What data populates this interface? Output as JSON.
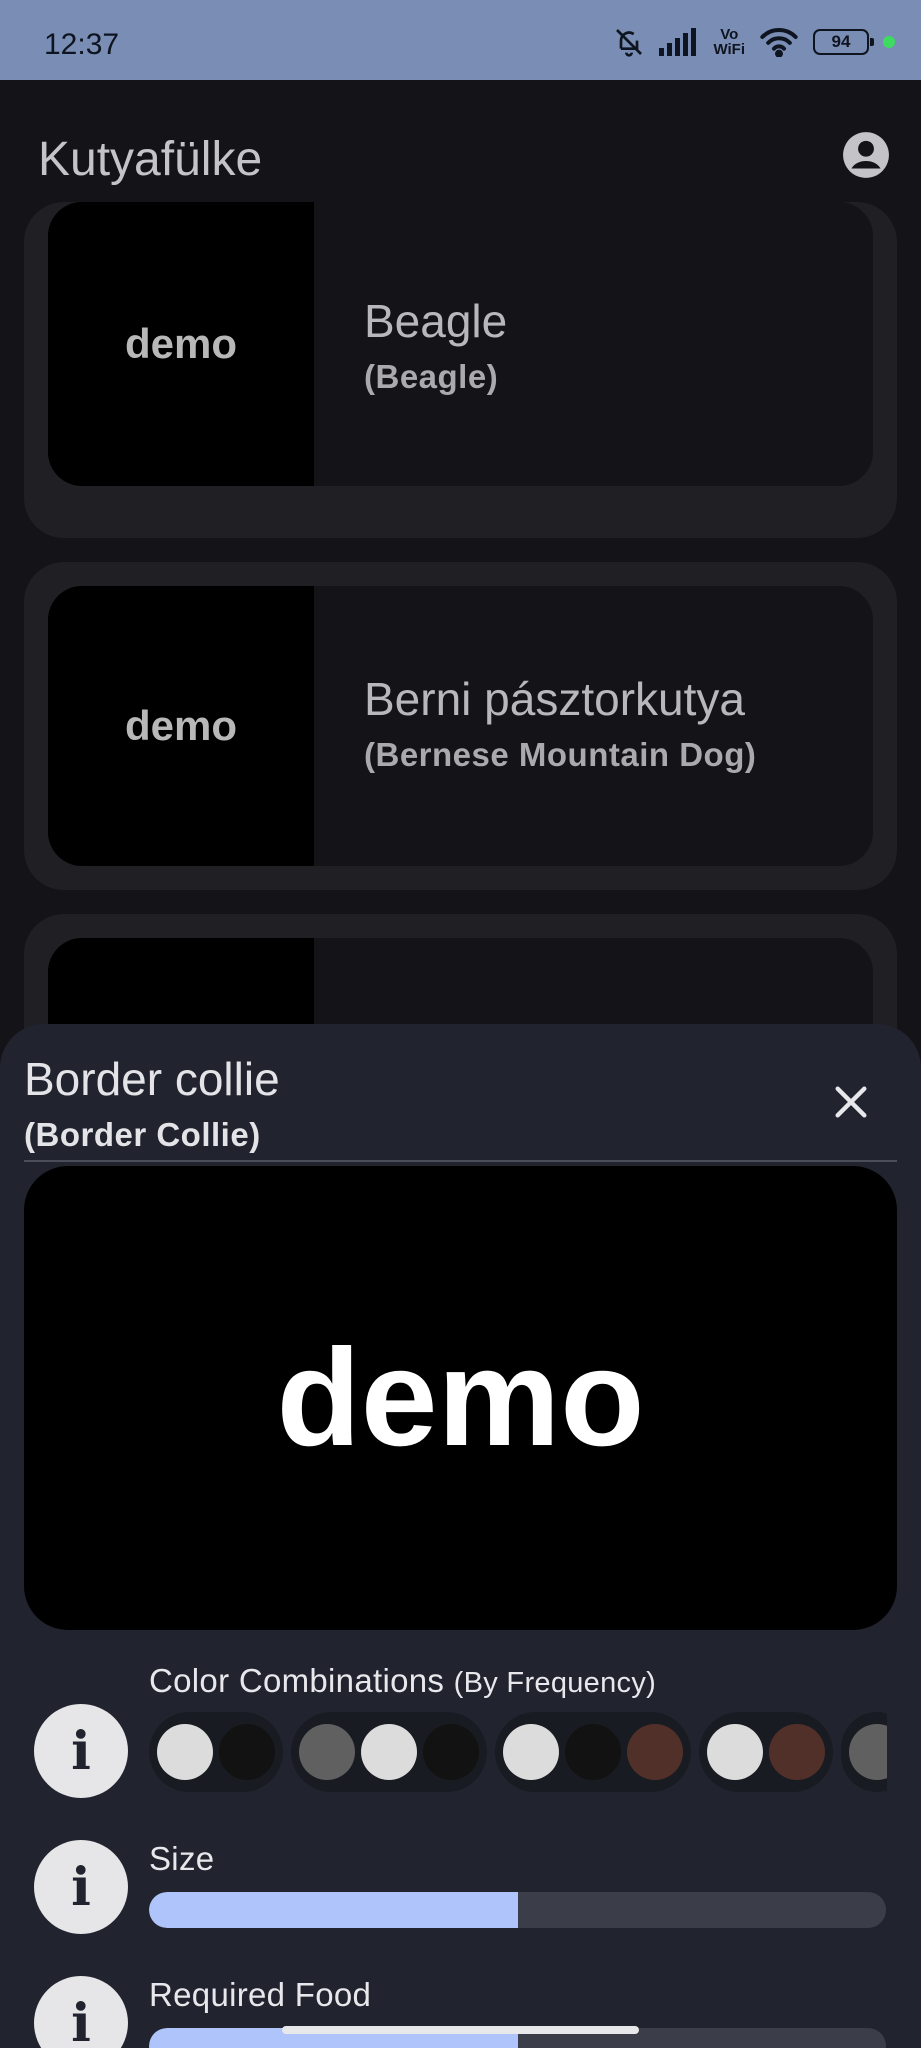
{
  "status_bar": {
    "time": "12:37",
    "network_label_top": "Vo",
    "network_label_bottom": "WiFi",
    "battery": "94",
    "icons": [
      "bell-muted-icon",
      "signal-icon",
      "vowifi-icon",
      "wifi-icon",
      "battery-icon"
    ]
  },
  "app_bar": {
    "title": "Kutyafülke",
    "account_icon": "account-circle-icon"
  },
  "list": {
    "items": [
      {
        "thumb_text": "demo",
        "name": "Beagle",
        "name_en": "(Beagle)"
      },
      {
        "thumb_text": "demo",
        "name": "Berni pásztorkutya",
        "name_en": "(Bernese Mountain Dog)"
      },
      {
        "thumb_text": "",
        "name": "",
        "name_en": ""
      }
    ]
  },
  "sheet": {
    "title": "Border collie",
    "subtitle": "(Border Collie)",
    "close_icon": "close-icon",
    "hero_text": "demo",
    "info_icon_text": "i",
    "color_section": {
      "label": "Color Combinations",
      "label_suffix": "(By Frequency)",
      "groups": [
        [
          "#dcdcdc",
          "#121212"
        ],
        [
          "#606060",
          "#dcdcdc",
          "#121212"
        ],
        [
          "#dcdcdc",
          "#121212",
          "#52302a"
        ],
        [
          "#dcdcdc",
          "#52302a"
        ],
        [
          "#606060"
        ]
      ]
    },
    "size": {
      "label": "Size",
      "value": 0.5
    },
    "food": {
      "label": "Required Food",
      "value": 0.5
    }
  },
  "colors": {
    "accent": "#aec4fb",
    "sheet_bg": "#21242f",
    "status_bar": "#7a8db4"
  }
}
